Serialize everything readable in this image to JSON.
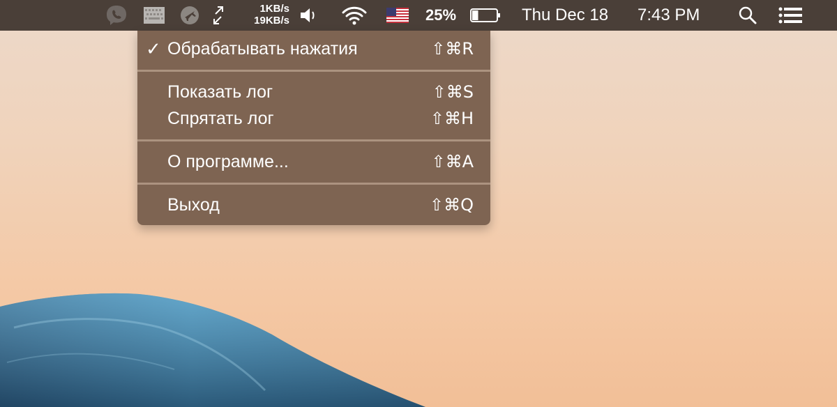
{
  "menubar": {
    "icons": [
      "viber-icon",
      "keyboard-layout-icon",
      "flight-mode-icon",
      "network-arrows-icon",
      "volume-icon",
      "wifi-icon",
      "us-flag-icon",
      "battery-icon",
      "spotlight-search-icon",
      "notification-center-icon"
    ],
    "network": {
      "upload": "1KB/s",
      "download": "19KB/s"
    },
    "battery_percent": "25%",
    "battery_level": 0.25,
    "date": "Thu Dec 18",
    "time": "7:43 PM"
  },
  "menu": {
    "items": [
      {
        "label": "Обрабатывать нажатия",
        "shortcut": "⇧⌘R",
        "checked": true,
        "check_glyph": "✓"
      },
      {
        "label": "Показать лог",
        "shortcut": "⇧⌘S"
      },
      {
        "label": "Спрятать лог",
        "shortcut": "⇧⌘H"
      },
      {
        "label": "О программе...",
        "shortcut": "⇧⌘A"
      },
      {
        "label": "Выход",
        "shortcut": "⇧⌘Q"
      }
    ]
  },
  "colors": {
    "menubar_bg": "#4a3f38",
    "menu_bg": "#7a604e",
    "wave": "#3d7fa8"
  }
}
